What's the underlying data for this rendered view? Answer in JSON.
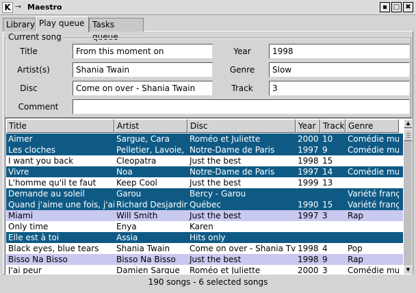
{
  "window": {
    "title": "Maestro",
    "app_icon": "K",
    "menu_arrow": "→",
    "minimize": "▪",
    "maximize": "□",
    "close": "✖"
  },
  "tabs": [
    {
      "label": "Library",
      "active": false
    },
    {
      "label": "Play queue",
      "active": true
    },
    {
      "label": "Tasks queue",
      "active": false
    }
  ],
  "current_song": {
    "group_title": "Current song",
    "title_label": "Title",
    "title_value": "From this moment on",
    "year_label": "Year",
    "year_value": "1998",
    "artist_label": "Artist(s)",
    "artist_value": "Shania Twain",
    "genre_label": "Genre",
    "genre_value": "Slow",
    "disc_label": "Disc",
    "disc_value": "Come on over - Shania Twain",
    "track_label": "Track",
    "track_value": "3",
    "comment_label": "Comment",
    "comment_value": ""
  },
  "table": {
    "columns": [
      "Title",
      "Artist",
      "Disc",
      "Year",
      "Track",
      "Genre"
    ],
    "rows": [
      {
        "style": "sel",
        "cells": [
          "Aimer",
          "Sargue, Cara",
          "Roméo et Juliette",
          "2000",
          "10",
          "Comédie mus"
        ]
      },
      {
        "style": "sel",
        "cells": [
          "Les cloches",
          "Pelletier, Lavoie,",
          "Notre-Dame de Paris",
          "1997",
          "9",
          "Comédie mus"
        ]
      },
      {
        "style": "norm",
        "cells": [
          "I want you back",
          "Cleopatra",
          "Just the best",
          "1998",
          "15",
          ""
        ]
      },
      {
        "style": "sel",
        "cells": [
          "Vivre",
          "Noa",
          "Notre-Dame de Paris",
          "1997",
          "14",
          "Comédie mus"
        ]
      },
      {
        "style": "norm",
        "cells": [
          "L'homme qu'il te faut",
          "Keep Cool",
          "Just the best",
          "1999",
          "13",
          ""
        ]
      },
      {
        "style": "sel",
        "cells": [
          "Demande au soleil",
          "Garou",
          "Bercy - Garou",
          "",
          "",
          "Variété franç"
        ]
      },
      {
        "style": "sel",
        "cells": [
          "Quand j'aime une fois, j'air",
          "Richard Desjardin",
          "Québec",
          "1990",
          "15",
          "Variété franç"
        ]
      },
      {
        "style": "alt",
        "cells": [
          "Miami",
          "Will Smith",
          "Just the best",
          "1997",
          "3",
          "Rap"
        ]
      },
      {
        "style": "norm",
        "cells": [
          "Only time",
          "Enya",
          "Karen",
          "",
          "",
          ""
        ]
      },
      {
        "style": "sel",
        "cells": [
          "Elle est à toi",
          "Assia",
          "Hits only",
          "",
          "",
          ""
        ]
      },
      {
        "style": "norm",
        "cells": [
          "Black eyes, blue tears",
          "Shania Twain",
          "Come on over - Shania Tv",
          "1998",
          "4",
          "Pop"
        ]
      },
      {
        "style": "alt",
        "cells": [
          "Bisso Na Bisso",
          "Bisso Na Bisso",
          "Just the best",
          "1998",
          "9",
          "Rap"
        ]
      },
      {
        "style": "norm",
        "cells": [
          "J'ai peur",
          "Damien Sargue",
          "Roméo et Juliette",
          "2000",
          "3",
          "Comédie mus"
        ]
      }
    ]
  },
  "scrollbar": {
    "up": "▲",
    "down": "▼"
  },
  "status": {
    "text": "190  songs - 6 selected songs"
  },
  "colors": {
    "selection": "#0f5a85",
    "alternate": "#c8c8f0"
  }
}
